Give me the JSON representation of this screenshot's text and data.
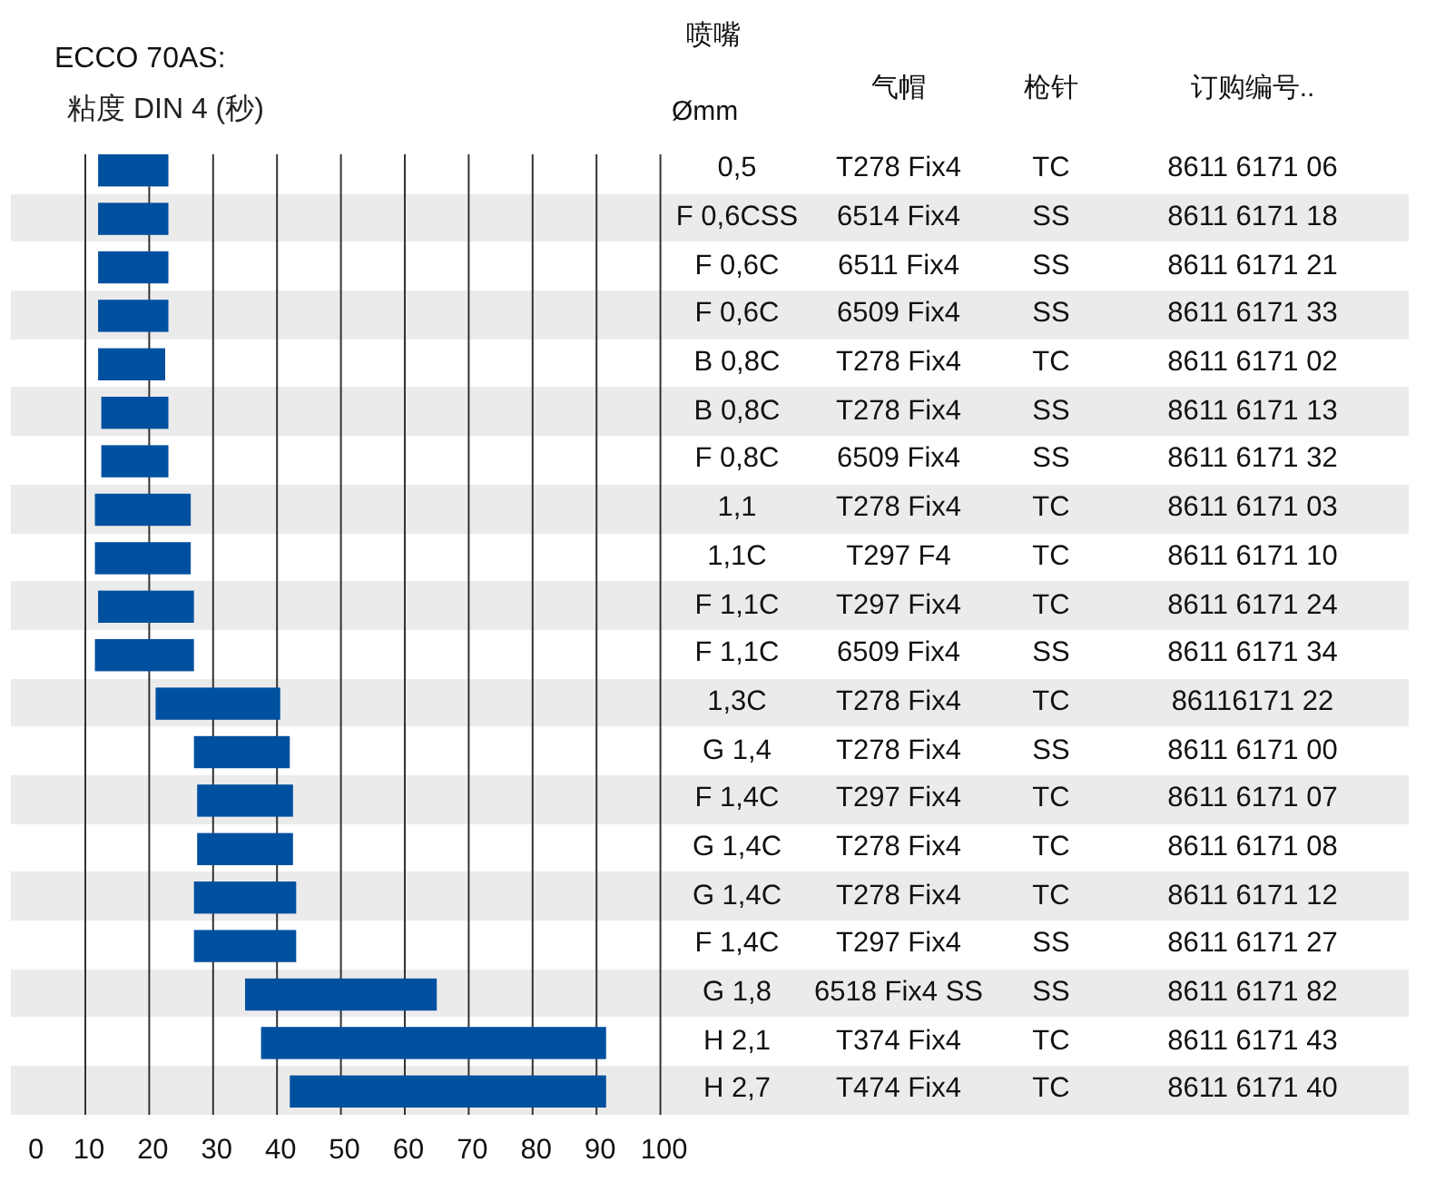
{
  "title": "ECCO  70AS:",
  "subtitle": "粘度  DIN 4 (秒)",
  "table": {
    "group_heading": "喷嘴",
    "columns": [
      "Ømm",
      "气帽",
      "枪针",
      "订购编号.."
    ],
    "rows": [
      {
        "nozzle": "0,5",
        "air_cap": "T278 Fix4",
        "needle": "TC",
        "order_no": "8611 6171 06"
      },
      {
        "nozzle": "F 0,6CSS",
        "air_cap": "6514  Fix4",
        "needle": "SS",
        "order_no": "8611 6171 18"
      },
      {
        "nozzle": "F 0,6C",
        "air_cap": "6511 Fix4",
        "needle": "SS",
        "order_no": "8611 6171 21"
      },
      {
        "nozzle": "F 0,6C",
        "air_cap": "6509 Fix4",
        "needle": "SS",
        "order_no": "8611 6171 33"
      },
      {
        "nozzle": "B 0,8C",
        "air_cap": "T278 Fix4",
        "needle": "TC",
        "order_no": "8611 6171 02"
      },
      {
        "nozzle": "B 0,8C",
        "air_cap": "T278 Fix4",
        "needle": "SS",
        "order_no": "8611 6171 13"
      },
      {
        "nozzle": "F 0,8C",
        "air_cap": "6509 Fix4",
        "needle": "SS",
        "order_no": "8611 6171 32"
      },
      {
        "nozzle": "1,1",
        "air_cap": "T278 Fix4",
        "needle": "TC",
        "order_no": "8611 6171 03"
      },
      {
        "nozzle": "1,1C",
        "air_cap": "T297 F4",
        "needle": "TC",
        "order_no": "8611 6171 10"
      },
      {
        "nozzle": "F 1,1C",
        "air_cap": "T297 Fix4",
        "needle": "TC",
        "order_no": "8611 6171 24"
      },
      {
        "nozzle": "F 1,1C",
        "air_cap": "6509 Fix4",
        "needle": "SS",
        "order_no": "8611 6171 34"
      },
      {
        "nozzle": "1,3C",
        "air_cap": "T278 Fix4",
        "needle": "TC",
        "order_no": "86116171 22"
      },
      {
        "nozzle": "G 1,4",
        "air_cap": "T278 Fix4",
        "needle": "SS",
        "order_no": "8611 6171 00"
      },
      {
        "nozzle": "F 1,4C",
        "air_cap": "T297 Fix4",
        "needle": "TC",
        "order_no": "8611 6171 07"
      },
      {
        "nozzle": "G 1,4C",
        "air_cap": "T278 Fix4",
        "needle": "TC",
        "order_no": "8611 6171 08"
      },
      {
        "nozzle": "G 1,4C",
        "air_cap": "T278 Fix4",
        "needle": "TC",
        "order_no": "8611 6171 12"
      },
      {
        "nozzle": "F 1,4C",
        "air_cap": "T297 Fix4",
        "needle": "SS",
        "order_no": "8611 6171 27"
      },
      {
        "nozzle": "G 1,8",
        "air_cap": "6518 Fix4  SS",
        "needle": "SS",
        "order_no": "8611 6171 82"
      },
      {
        "nozzle": "H 2,1",
        "air_cap": "T374 Fix4",
        "needle": "TC",
        "order_no": "8611 6171 43"
      },
      {
        "nozzle": "H 2,7",
        "air_cap": "T474 Fix4",
        "needle": "TC",
        "order_no": "8611 6171 40"
      }
    ]
  },
  "chart_data": {
    "type": "candlestick",
    "orientation": "horizontal",
    "grid": true,
    "color": "#0050a0",
    "xlim": [
      0,
      100
    ],
    "xticks": [
      0,
      10,
      20,
      30,
      40,
      50,
      60,
      70,
      80,
      90,
      100
    ],
    "ohlc": [
      [
        12,
        23,
        12,
        23
      ],
      [
        12,
        23,
        12,
        23
      ],
      [
        12,
        23,
        12,
        23
      ],
      [
        12,
        23,
        12,
        23
      ],
      [
        12,
        22.5,
        12,
        22.5
      ],
      [
        12.5,
        23,
        12.5,
        23
      ],
      [
        12.5,
        23,
        12.5,
        23
      ],
      [
        11.5,
        26.5,
        11.5,
        26.5
      ],
      [
        11.5,
        26.5,
        11.5,
        26.5
      ],
      [
        12,
        27,
        12,
        27
      ],
      [
        11.5,
        27,
        11.5,
        27
      ],
      [
        21,
        40.5,
        21,
        40.5
      ],
      [
        27,
        42,
        27,
        42
      ],
      [
        27.5,
        42.5,
        27.5,
        42.5
      ],
      [
        27.5,
        42.5,
        27.5,
        42.5
      ],
      [
        27,
        43,
        27,
        43
      ],
      [
        27,
        43,
        27,
        43
      ],
      [
        35,
        65,
        35,
        65
      ],
      [
        37.5,
        91.5,
        37.5,
        91.5
      ],
      [
        42,
        91.5,
        42,
        91.5
      ]
    ]
  }
}
